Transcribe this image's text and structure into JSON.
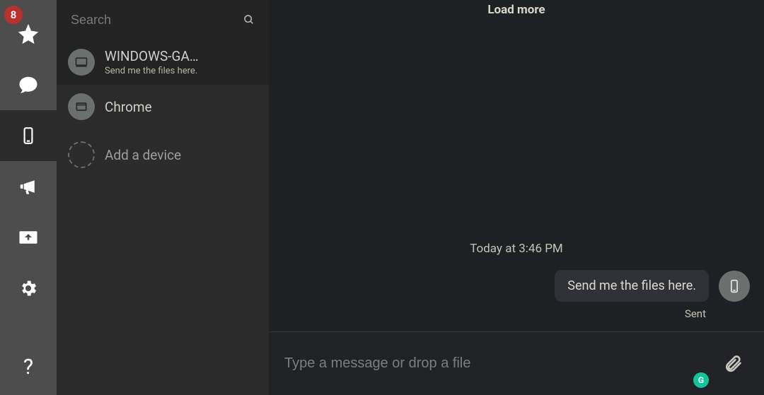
{
  "nav": {
    "badge": "8"
  },
  "search": {
    "placeholder": "Search"
  },
  "devices": [
    {
      "name": "WINDOWS-GA…",
      "preview": "Send me the files here."
    },
    {
      "name": "Chrome",
      "preview": ""
    }
  ],
  "add_device_label": "Add a device",
  "chat": {
    "load_more": "Load more",
    "timestamp": "Today at 3:46 PM",
    "message": "Send me the files here.",
    "status": "Sent"
  },
  "composer": {
    "placeholder": "Type a message or drop a file"
  },
  "grammarly": {
    "glyph": "G"
  }
}
